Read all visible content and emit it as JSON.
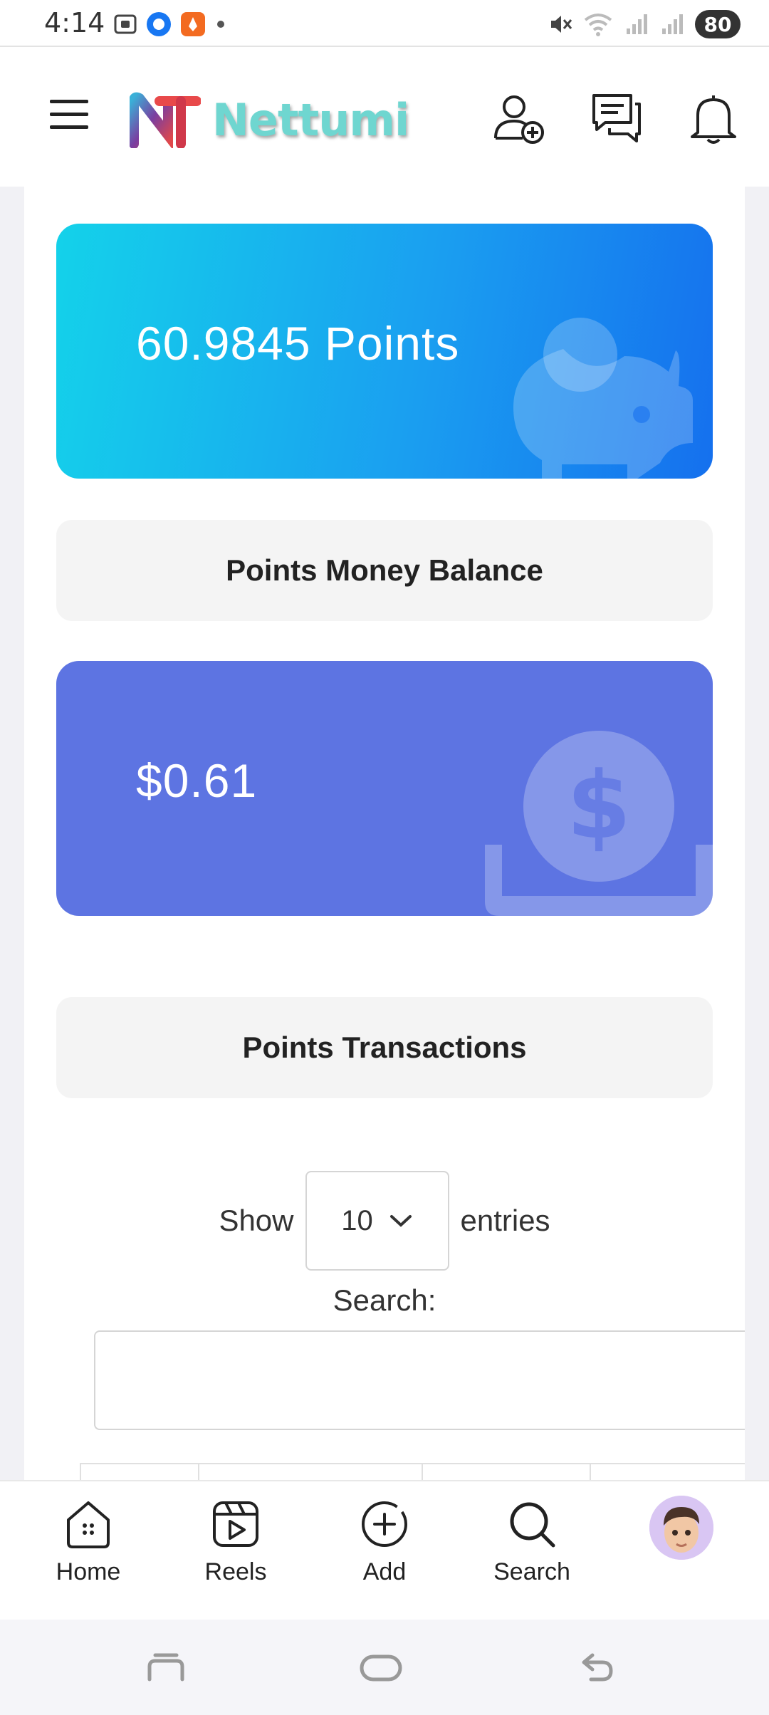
{
  "status_bar": {
    "time": "4:14",
    "battery": "80"
  },
  "header": {
    "brand": "Nettumi",
    "icons": [
      "menu-icon",
      "add-friend-icon",
      "messages-icon",
      "notifications-icon"
    ]
  },
  "points_card": {
    "value": "60.9845 Points",
    "icon": "piggy-bank-icon"
  },
  "money_section": {
    "title": "Points Money Balance"
  },
  "money_card": {
    "value": "$0.61",
    "icon": "dollar-deposit-icon"
  },
  "transactions": {
    "title": "Points Transactions",
    "show_label": "Show",
    "entries_value": "10",
    "entries_label": "entries",
    "search_label": "Search:",
    "search_value": ""
  },
  "bottom_nav": {
    "items": [
      {
        "label": "Home",
        "icon": "home-icon"
      },
      {
        "label": "Reels",
        "icon": "reels-icon"
      },
      {
        "label": "Add",
        "icon": "add-icon"
      },
      {
        "label": "Search",
        "icon": "search-icon"
      }
    ],
    "profile_icon": "avatar"
  },
  "colors": {
    "points_gradient_start": "#14d2ea",
    "points_gradient_end": "#1570ee",
    "money_card": "#5d74e2",
    "section_bg": "#f4f4f4"
  }
}
